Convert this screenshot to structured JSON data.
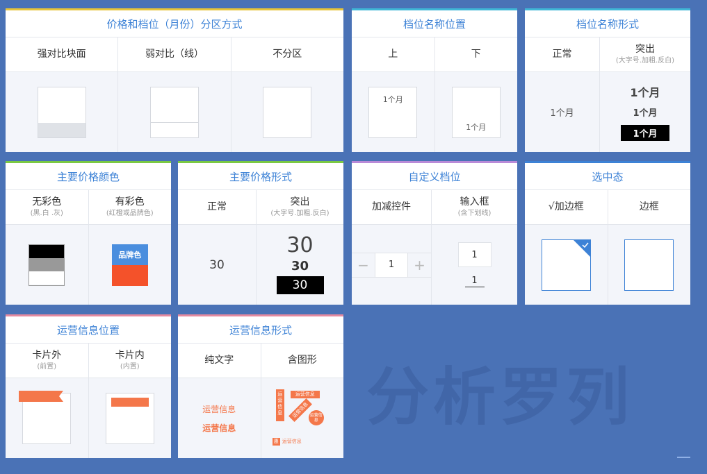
{
  "cards": {
    "partition": {
      "title": "价格和档位（月份）分区方式",
      "cols": [
        "强对比块面",
        "弱对比（线）",
        "不分区"
      ]
    },
    "name_position": {
      "title": "档位名称位置",
      "cols": [
        "上",
        "下"
      ],
      "sample": "1个月"
    },
    "name_form": {
      "title": "档位名称形式",
      "normal_label": "正常",
      "bold_label": "突出",
      "bold_sub": "(大字号.加粗.反白)",
      "sample": "1个月"
    },
    "price_color": {
      "title": "主要价格颜色",
      "col1_label": "无彩色",
      "col1_sub": "(黑.白 .灰)",
      "col2_label": "有彩色",
      "col2_sub": "(红橙或品牌色)",
      "brand_text": "品牌色",
      "colors": {
        "black": "#000000",
        "gray": "#999999",
        "blue": "#4a8ede",
        "orange": "#f4522a"
      }
    },
    "price_form": {
      "title": "主要价格形式",
      "normal_label": "正常",
      "bold_label": "突出",
      "bold_sub": "(大字号.加粗.反白)",
      "sample": "30"
    },
    "custom_tier": {
      "title": "自定义档位",
      "col1_label": "加减控件",
      "col2_label": "输入框",
      "col2_sub": "(含下划线)",
      "stepper_value": "1",
      "minus": "−",
      "plus": "+",
      "input_value": "1"
    },
    "selected_state": {
      "title": "选中态",
      "col1_label": "√加边框",
      "col2_label": "边框",
      "accent": "#3d82d6"
    },
    "ops_position": {
      "title": "运营信息位置",
      "col1_label": "卡片外",
      "col1_sub": "(前置)",
      "col2_label": "卡片内",
      "col2_sub": "(内置)",
      "accent": "#f4774a"
    },
    "ops_form": {
      "title": "运营信息形式",
      "col1_label": "纯文字",
      "col2_label": "含图形",
      "text_normal": "运营信息",
      "text_bold": "运营信息",
      "tag_vertical": "运营信息",
      "tag_ribbon": "运营信息",
      "tag_diag": "运营信息",
      "tag_circle": "运营信息",
      "tag_badge_icon": "惠",
      "tag_badge_text": "运营信息"
    }
  },
  "watermark": "分析罗列"
}
